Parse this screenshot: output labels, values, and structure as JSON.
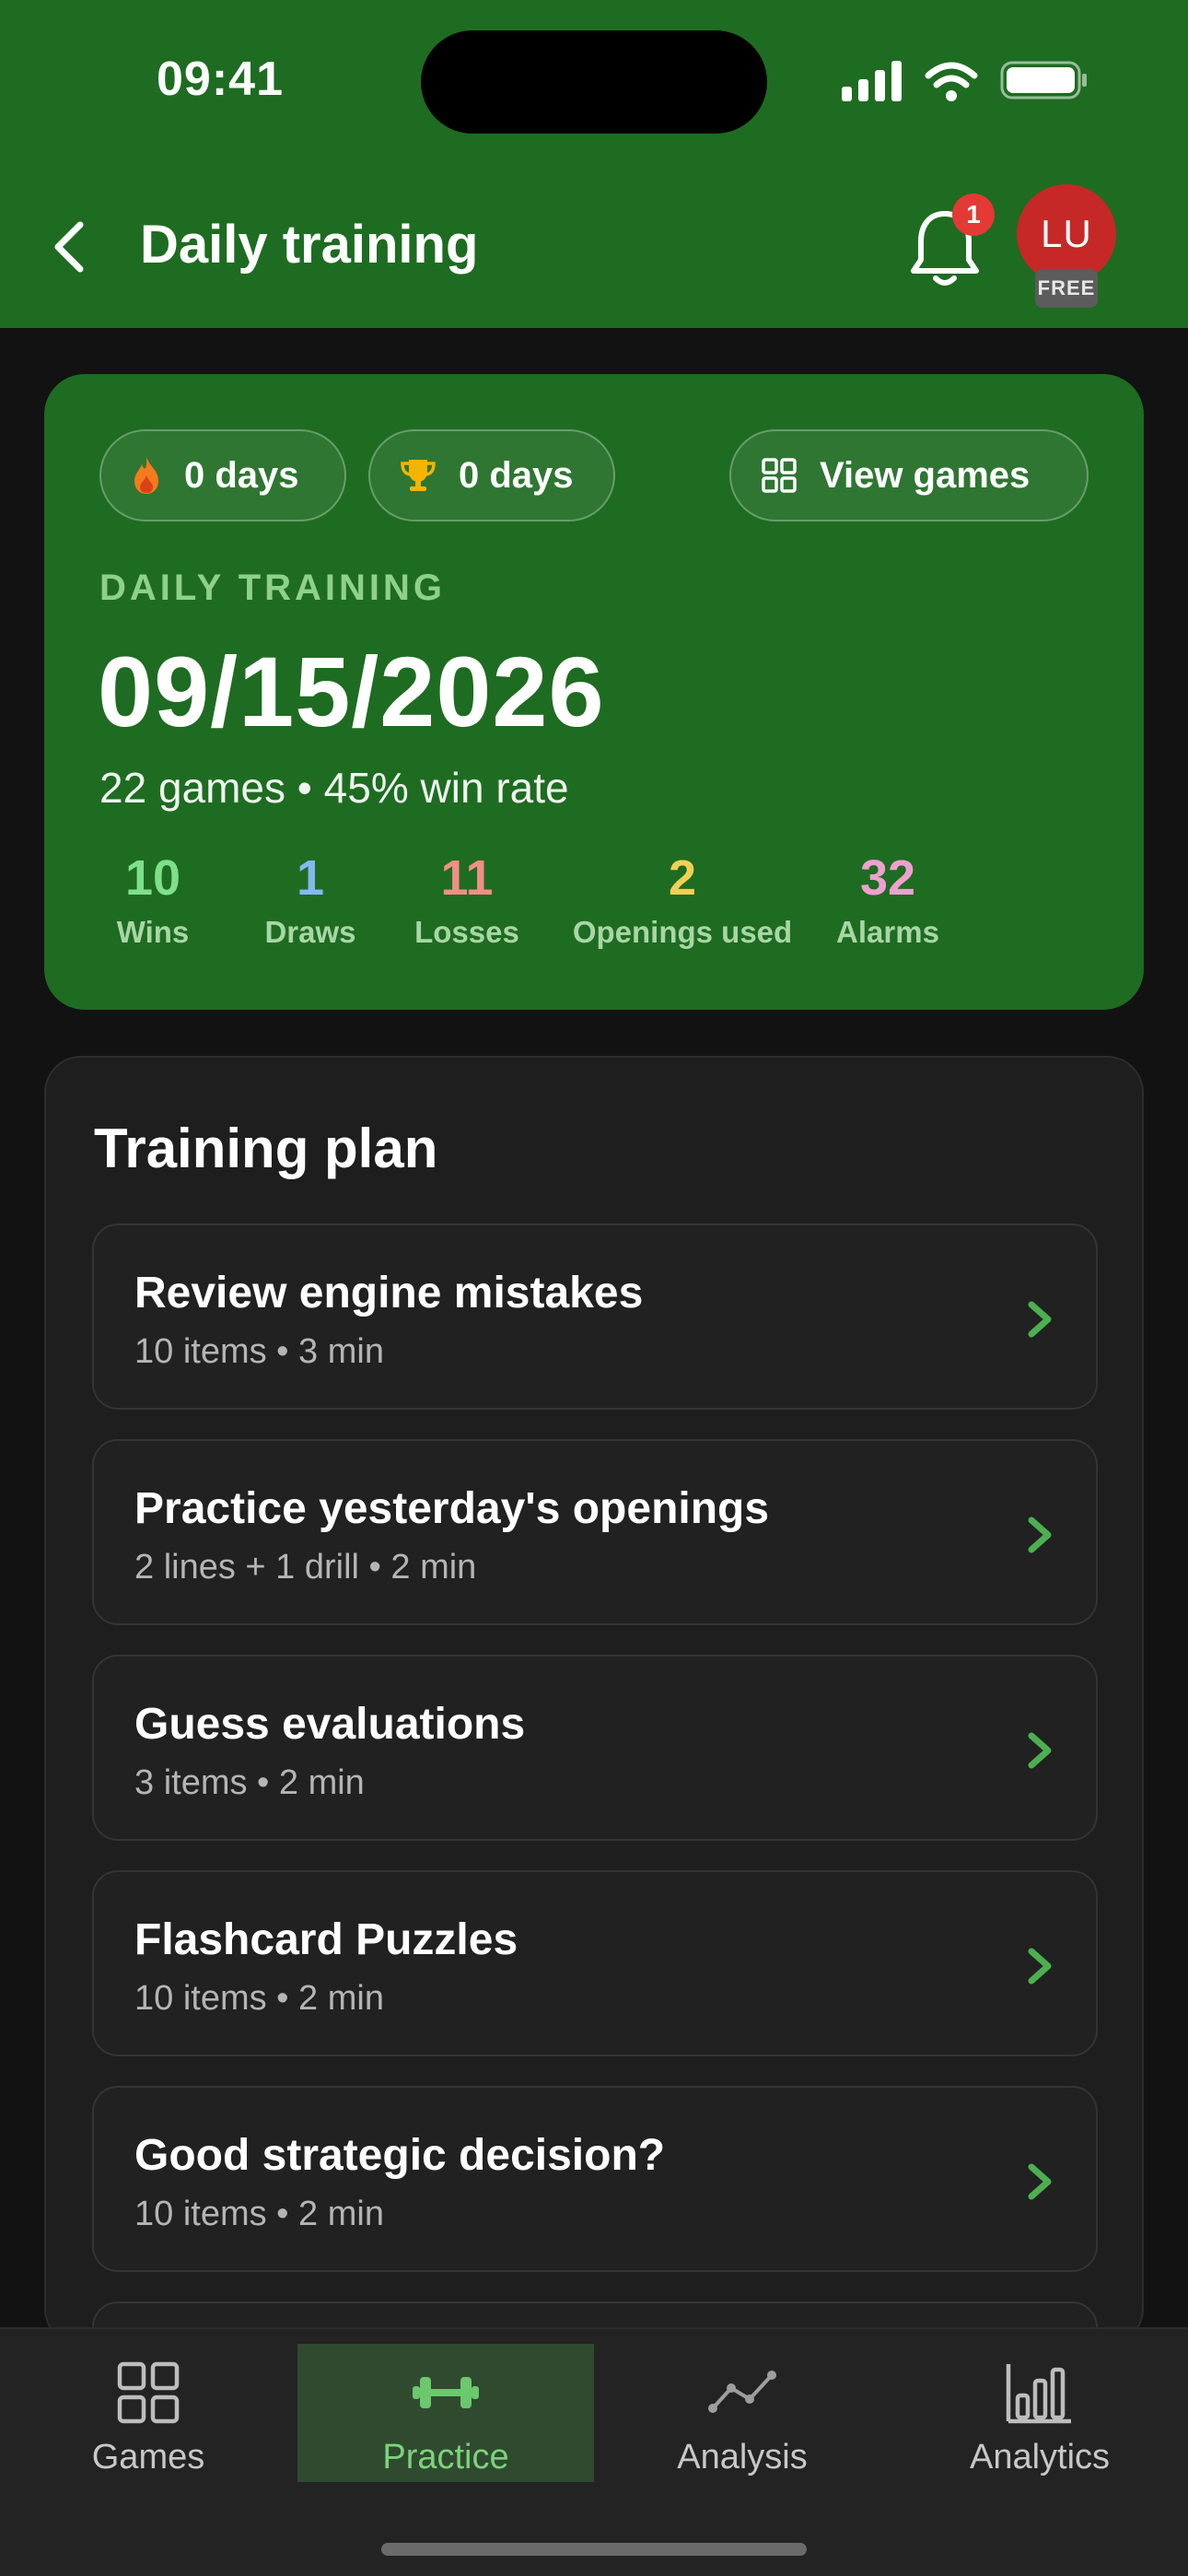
{
  "status_bar": {
    "time": "09:41"
  },
  "header": {
    "title": "Daily training",
    "notification_count": "1",
    "avatar_initials": "LU",
    "plan_badge": "FREE"
  },
  "summary": {
    "current_streak": "0 days",
    "best_streak": "0 days",
    "view_games_label": "View games",
    "section_label": "DAILY TRAINING",
    "date": "09/15/2026",
    "games_line": "22 games • 45% win rate",
    "stats": [
      {
        "value": "10",
        "label": "Wins",
        "color": "#7ee08a"
      },
      {
        "value": "1",
        "label": "Draws",
        "color": "#86b8f0"
      },
      {
        "value": "11",
        "label": "Losses",
        "color": "#f08f86"
      },
      {
        "value": "2",
        "label": "Openings used",
        "color": "#f2cf55"
      },
      {
        "value": "32",
        "label": "Alarms",
        "color": "#f0a0cf"
      }
    ]
  },
  "plan": {
    "title": "Training plan",
    "items": [
      {
        "name": "Review engine mistakes",
        "meta": "10 items • 3 min"
      },
      {
        "name": "Practice yesterday's openings",
        "meta": "2 lines + 1 drill • 2 min"
      },
      {
        "name": "Guess evaluations",
        "meta": "3 items • 2 min"
      },
      {
        "name": "Flashcard Puzzles",
        "meta": "10 items • 2 min"
      },
      {
        "name": "Good strategic decision?",
        "meta": "10 items • 2 min"
      }
    ]
  },
  "tabs": [
    {
      "label": "Games",
      "icon": "grid-icon"
    },
    {
      "label": "Practice",
      "icon": "dumbbell-icon",
      "active": true
    },
    {
      "label": "Analysis",
      "icon": "line-chart-icon"
    },
    {
      "label": "Analytics",
      "icon": "bar-chart-icon"
    }
  ],
  "colors": {
    "brand_green": "#1e6b22",
    "accent_green": "#4caf50",
    "background": "#121212"
  }
}
